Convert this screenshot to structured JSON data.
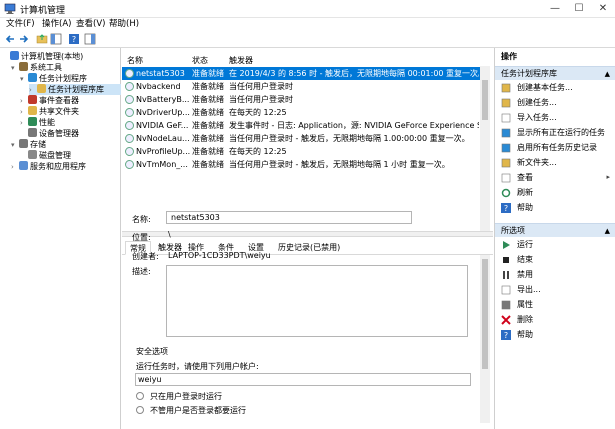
{
  "window": {
    "title": "计算机管理"
  },
  "menu": [
    "文件(F)",
    "操作(A)",
    "查看(V)",
    "帮助(H)"
  ],
  "tree": [
    {
      "label": "计算机管理(本地)",
      "indent": 0,
      "arrow": ""
    },
    {
      "label": "系统工具",
      "indent": 1,
      "arrow": "▾"
    },
    {
      "label": "任务计划程序",
      "indent": 2,
      "arrow": "▾"
    },
    {
      "label": "任务计划程序库",
      "indent": 3,
      "arrow": "›"
    },
    {
      "label": "事件查看器",
      "indent": 2,
      "arrow": "›"
    },
    {
      "label": "共享文件夹",
      "indent": 2,
      "arrow": "›"
    },
    {
      "label": "性能",
      "indent": 2,
      "arrow": "›"
    },
    {
      "label": "设备管理器",
      "indent": 2,
      "arrow": ""
    },
    {
      "label": "存储",
      "indent": 1,
      "arrow": "▾"
    },
    {
      "label": "磁盘管理",
      "indent": 2,
      "arrow": ""
    },
    {
      "label": "服务和应用程序",
      "indent": 1,
      "arrow": "›"
    }
  ],
  "list": {
    "headers": [
      "名称",
      "状态",
      "触发器"
    ],
    "rows": [
      {
        "name": "netstat5303",
        "status": "准备就绪",
        "trigger": "在 2019/4/3 的 8:56 时 - 触发后，无限期地每隔 00:01:00 重复一次。"
      },
      {
        "name": "Nvbackend",
        "status": "准备就绪",
        "trigger": "当任何用户登录时"
      },
      {
        "name": "NvBatteryB...",
        "status": "准备就绪",
        "trigger": "当任何用户登录时"
      },
      {
        "name": "NvDriverUp...",
        "status": "准备就绪",
        "trigger": "在每天的 12:25"
      },
      {
        "name": "NVIDIA GeF...",
        "status": "准备就绪",
        "trigger": "发生事件时 - 日志: Application，源: NVIDIA GeForce Experience SelfUpdat"
      },
      {
        "name": "NvNodeLau...",
        "status": "准备就绪",
        "trigger": "当任何用户登录时 - 触发后，无限期地每隔 1.00:00:00 重复一次。"
      },
      {
        "name": "NvProfileUp...",
        "status": "准备就绪",
        "trigger": "在每天的 12:25"
      },
      {
        "name": "NvTmMon_...",
        "status": "准备就绪",
        "trigger": "当任何用户登录时 - 触发后，无限期地每隔 1 小时 重复一次。"
      }
    ]
  },
  "tabs": [
    "常规",
    "触发器",
    "操作",
    "条件",
    "设置",
    "历史记录(已禁用)"
  ],
  "details": {
    "name_label": "名称:",
    "name_value": "netstat5303",
    "location_label": "位置:",
    "location_value": "\\",
    "author_label": "创建者:",
    "author_value": "LAPTOP-1CD33PDT\\weiyu",
    "desc_label": "描述:",
    "security_title": "安全选项",
    "run_as_text": "运行任务时，请使用下列用户帐户:",
    "user_account": "weiyu",
    "radio1": "只在用户登录时运行",
    "radio2": "不管用户是否登录都要运行"
  },
  "actions": {
    "title": "操作",
    "section1": "任务计划程序库",
    "section1_items": [
      {
        "label": "创建基本任务...",
        "icon": "create-basic-task-icon",
        "more": ""
      },
      {
        "label": "创建任务...",
        "icon": "create-task-icon",
        "more": ""
      },
      {
        "label": "导入任务...",
        "icon": "import-task-icon",
        "more": ""
      },
      {
        "label": "显示所有正在运行的任务",
        "icon": "show-running-icon",
        "more": ""
      },
      {
        "label": "启用所有任务历史记录",
        "icon": "history-icon",
        "more": ""
      },
      {
        "label": "新文件夹...",
        "icon": "new-folder-icon",
        "more": ""
      },
      {
        "label": "查看",
        "icon": "view-icon",
        "more": "▸"
      },
      {
        "label": "刷新",
        "icon": "refresh-icon",
        "more": ""
      },
      {
        "label": "帮助",
        "icon": "help-icon",
        "more": ""
      }
    ],
    "section2": "所选项",
    "section2_items": [
      {
        "label": "运行",
        "icon": "run-icon",
        "more": ""
      },
      {
        "label": "结束",
        "icon": "stop-icon",
        "more": ""
      },
      {
        "label": "禁用",
        "icon": "disable-icon",
        "more": ""
      },
      {
        "label": "导出...",
        "icon": "export-icon",
        "more": ""
      },
      {
        "label": "属性",
        "icon": "properties-icon",
        "more": ""
      },
      {
        "label": "删除",
        "icon": "delete-icon",
        "more": ""
      },
      {
        "label": "帮助",
        "icon": "help-icon",
        "more": ""
      }
    ]
  },
  "colors": {
    "selection": "#0078d7",
    "section_bg": "#dbe8f5",
    "tree_selected": "#cce4f7"
  }
}
